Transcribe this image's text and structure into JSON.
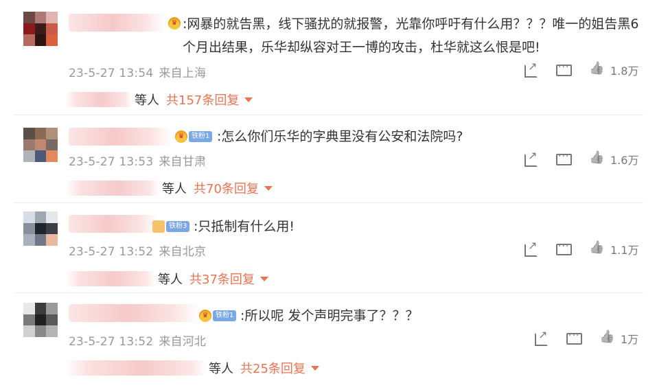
{
  "comments": [
    {
      "text": ":网暴的就告黑，线下骚扰的就报警，光靠你呼吁有什么用？？？唯一的姐告黑6个月出结果，乐华却纵容对王一博的攻击，杜华就这么恨是吧!",
      "date": "23-5-27 13:54",
      "location": "来自上海",
      "likes": "1.8万",
      "fan_level": "",
      "reply_who": "等人",
      "reply_count": "共157条回复",
      "avatar_colors": [
        "#6b4a45",
        "#b07a74",
        "#e0b4b0",
        "#8c1a1a",
        "#3a1c1a",
        "#c85a4a",
        "#b86a5e",
        "#2d1412",
        "#d8603c"
      ]
    },
    {
      "text": ":怎么你们乐华的字典里没有公安和法院吗?",
      "date": "23-5-27 13:53",
      "location": "来自甘肃",
      "likes": "1.6万",
      "fan_level": "铁粉1",
      "reply_who": "等人",
      "reply_count": "共70条回复",
      "avatar_colors": [
        "#5a5048",
        "#8a6a52",
        "#b09078",
        "#9a7a6a",
        "#c08870",
        "#7a6a66",
        "#b0b4b8",
        "#4a5a78",
        "#e08a60"
      ]
    },
    {
      "text": ":只抵制有什么用!",
      "date": "23-5-27 13:52",
      "location": "来自北京",
      "likes": "1.1万",
      "fan_level": "铁粉3",
      "reply_who": "等人",
      "reply_count": "共37条回复",
      "avatar_colors": [
        "#d8dce4",
        "#a0a8b4",
        "#e6e8ec",
        "#8890a0",
        "#20242c",
        "#3a3e46",
        "#aab0bc",
        "#707888",
        "#e8b8a0"
      ]
    },
    {
      "text": ":所以呢 发个声明完事了？？？",
      "date": "23-5-27 13:52",
      "location": "来自河北",
      "likes": "1万",
      "fan_level": "铁粉1",
      "reply_who": "等人",
      "reply_count": "共25条回复",
      "avatar_colors": [
        "#e8e8e8",
        "#3c3c3c",
        "#9a9a9a",
        "#7a7a7a",
        "#202020",
        "#5a5a5a",
        "#d0d0d0",
        "#8a8a8a",
        "#b4b4b4"
      ]
    }
  ]
}
